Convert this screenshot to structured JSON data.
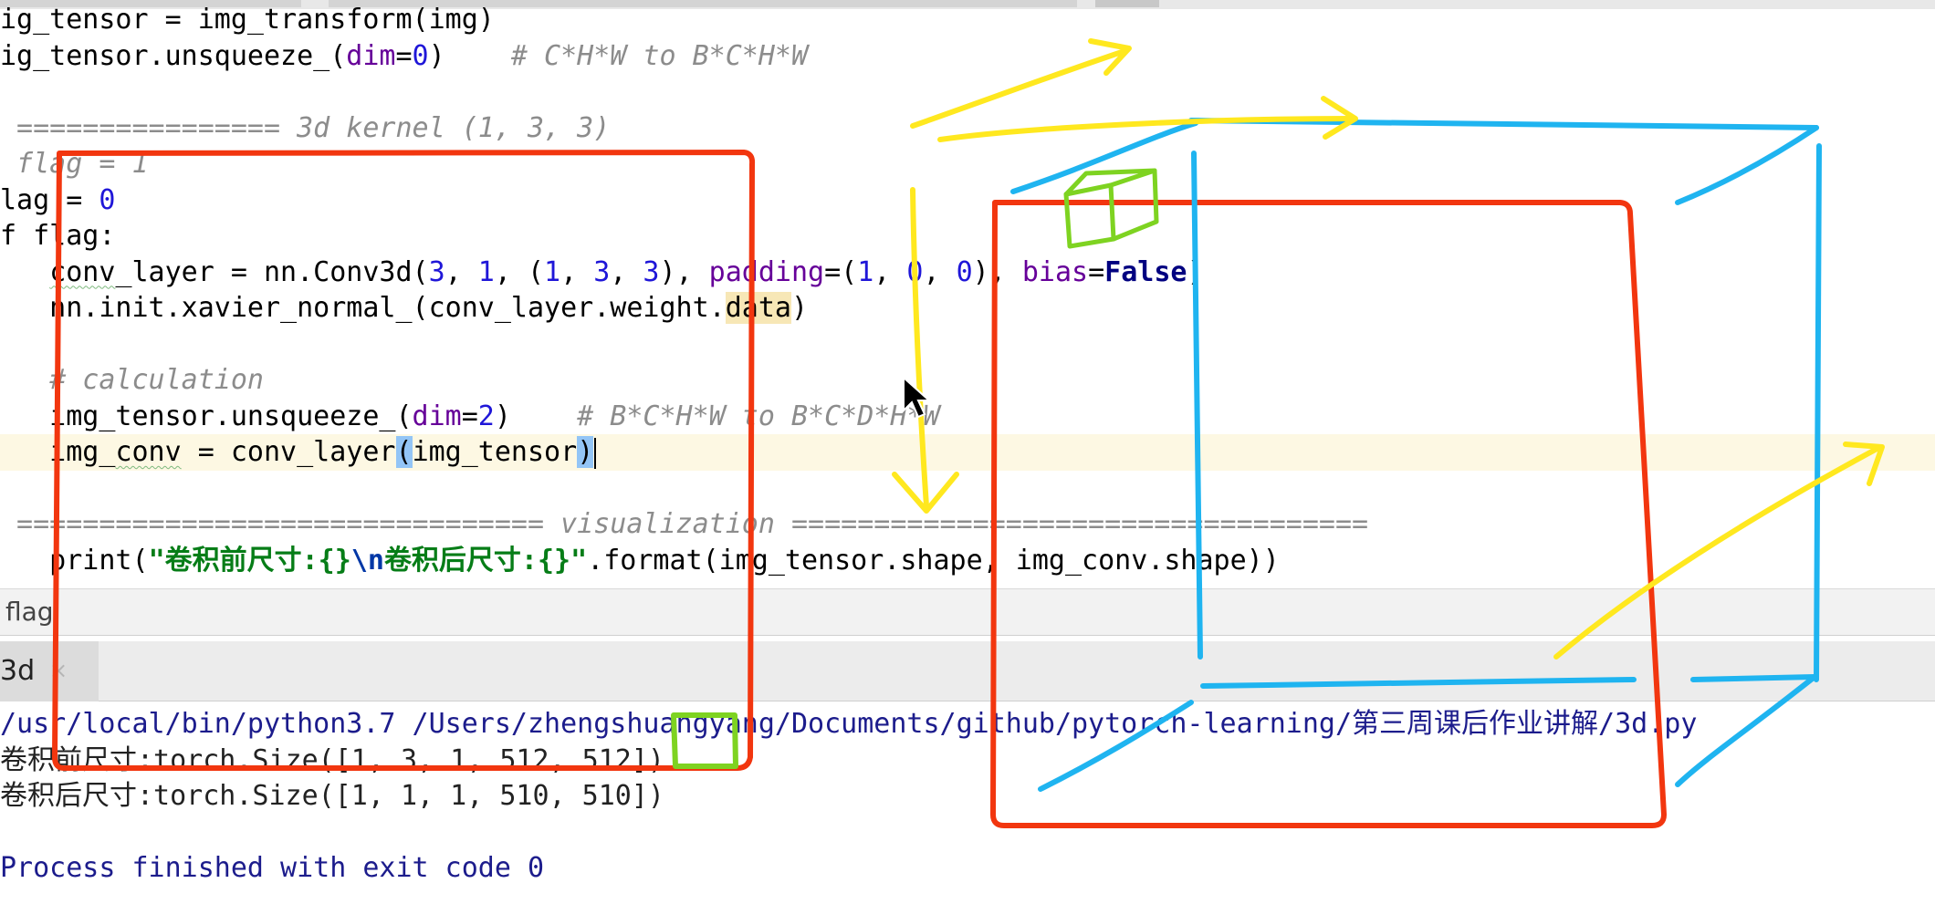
{
  "editor": {
    "lines": [
      {
        "tokens": [
          {
            "t": "ig_tensor = img_transform(img)"
          }
        ]
      },
      {
        "tokens": [
          {
            "t": "ig_tensor.unsqueeze_("
          },
          {
            "t": "dim",
            "c": "kwarg"
          },
          {
            "t": "="
          },
          {
            "t": "0",
            "c": "num"
          },
          {
            "t": ")    "
          },
          {
            "t": "# C*H*W to B*C*H*W",
            "c": "cm"
          }
        ]
      },
      {
        "tokens": []
      },
      {
        "tokens": [
          {
            "t": " ================ 3d kernel (1, 3, 3)",
            "c": "cm"
          }
        ]
      },
      {
        "tokens": [
          {
            "t": " flag = 1",
            "c": "cm"
          }
        ]
      },
      {
        "tokens": [
          {
            "t": "lag = "
          },
          {
            "t": "0",
            "c": "num"
          }
        ]
      },
      {
        "tokens": [
          {
            "t": "f flag:"
          }
        ]
      },
      {
        "tokens": [
          {
            "t": "   "
          },
          {
            "t": "conv",
            "c": "sq"
          },
          {
            "t": "_layer = nn.Conv3d("
          },
          {
            "t": "3",
            "c": "num"
          },
          {
            "t": ", "
          },
          {
            "t": "1",
            "c": "num"
          },
          {
            "t": ", ("
          },
          {
            "t": "1",
            "c": "num"
          },
          {
            "t": ", "
          },
          {
            "t": "3",
            "c": "num"
          },
          {
            "t": ", "
          },
          {
            "t": "3",
            "c": "num"
          },
          {
            "t": "), "
          },
          {
            "t": "padding",
            "c": "kwarg"
          },
          {
            "t": "=("
          },
          {
            "t": "1",
            "c": "num"
          },
          {
            "t": ", "
          },
          {
            "t": "0",
            "c": "num"
          },
          {
            "t": ", "
          },
          {
            "t": "0",
            "c": "num"
          },
          {
            "t": "), "
          },
          {
            "t": "bias",
            "c": "kwarg"
          },
          {
            "t": "="
          },
          {
            "t": "False",
            "c": "kw"
          },
          {
            "t": ")"
          }
        ]
      },
      {
        "tokens": [
          {
            "t": "   nn.init.xavier_normal_(conv_layer.weight."
          },
          {
            "t": "data",
            "c": "hl"
          },
          {
            "t": ")"
          }
        ]
      },
      {
        "tokens": []
      },
      {
        "tokens": [
          {
            "t": "   "
          },
          {
            "t": "# calculation",
            "c": "cm"
          }
        ]
      },
      {
        "tokens": [
          {
            "t": "   img_tensor.unsqueeze_("
          },
          {
            "t": "dim",
            "c": "kwarg"
          },
          {
            "t": "="
          },
          {
            "t": "2",
            "c": "num"
          },
          {
            "t": ")    "
          },
          {
            "t": "# B*C*H*W to B*C*D*H*W",
            "c": "cm"
          }
        ]
      },
      {
        "tokens": [
          {
            "t": "   img_"
          },
          {
            "t": "conv",
            "c": "sq"
          },
          {
            "t": " = conv_layer"
          },
          {
            "t": "(",
            "c": "bm"
          },
          {
            "t": "img_tensor"
          },
          {
            "t": ")",
            "c": "bm"
          },
          {
            "t": "",
            "c": "caret"
          }
        ],
        "current": true
      },
      {
        "tokens": []
      },
      {
        "tokens": [
          {
            "t": " ================================ visualization ===================================",
            "c": "cm"
          }
        ]
      },
      {
        "tokens": [
          {
            "t": "   print("
          },
          {
            "t": "\"卷积前尺寸:{}",
            "c": "str"
          },
          {
            "t": "\\n",
            "c": "esc"
          },
          {
            "t": "卷积后尺寸:{}\"",
            "c": "str"
          },
          {
            "t": ".format(img_tensor.shape, img_conv.shape))"
          }
        ]
      }
    ]
  },
  "breadcrumb": {
    "label": "flag"
  },
  "run": {
    "tab_label": "3d",
    "tab_close": "×",
    "console_lines": [
      {
        "text": "/usr/local/bin/python3.7 /Users/zhengshuangyang/Documents/github/pytorch-learning/第三周课后作业讲解/3d.py",
        "kind": "cmd"
      },
      {
        "text": "卷积前尺寸:torch.Size([1, 3, 1, 512, 512])",
        "kind": "out"
      },
      {
        "text": "卷积后尺寸:torch.Size([1, 1, 1, 510, 510])",
        "kind": "out"
      },
      {
        "text": "",
        "kind": "out"
      },
      {
        "text": "Process finished with exit code 0",
        "kind": "fin"
      }
    ]
  },
  "colors": {
    "annotation_red": "#f2360f",
    "annotation_blue": "#1fb4f0",
    "annotation_yellow": "#ffe81f",
    "annotation_green": "#7ed321"
  }
}
